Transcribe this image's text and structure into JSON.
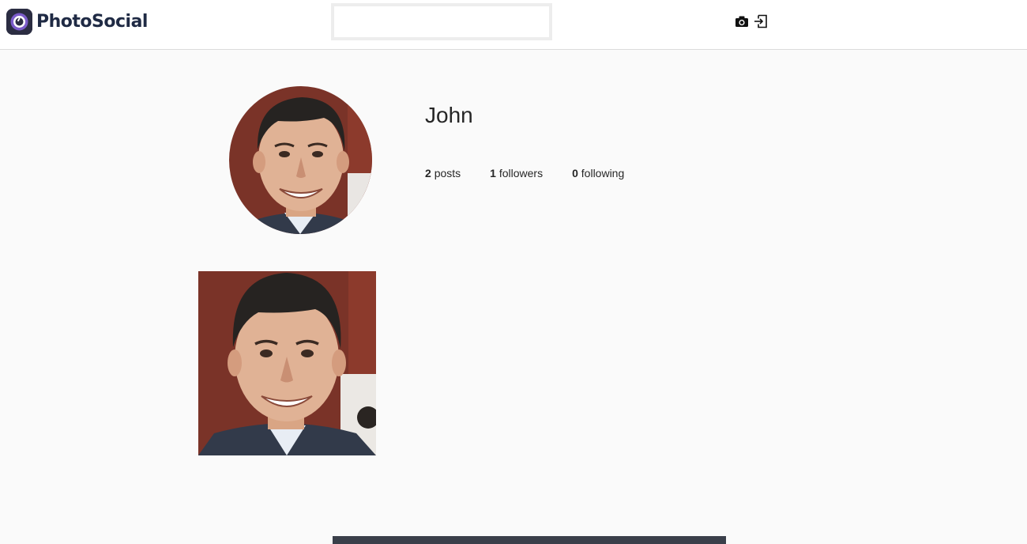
{
  "header": {
    "logo_text": "PhotoSocial",
    "search": {
      "value": "",
      "placeholder": ""
    },
    "icons": [
      "camera-icon",
      "logout-icon"
    ]
  },
  "profile": {
    "username": "John",
    "stats": {
      "posts_count": "2",
      "posts_label": "posts",
      "followers_count": "1",
      "followers_label": "followers",
      "following_count": "0",
      "following_label": "following"
    }
  },
  "colors": {
    "background": "#fafafa",
    "header_bg": "#ffffff",
    "logo_dark": "#2b2d42",
    "logo_accent": "#7b5cc9"
  }
}
